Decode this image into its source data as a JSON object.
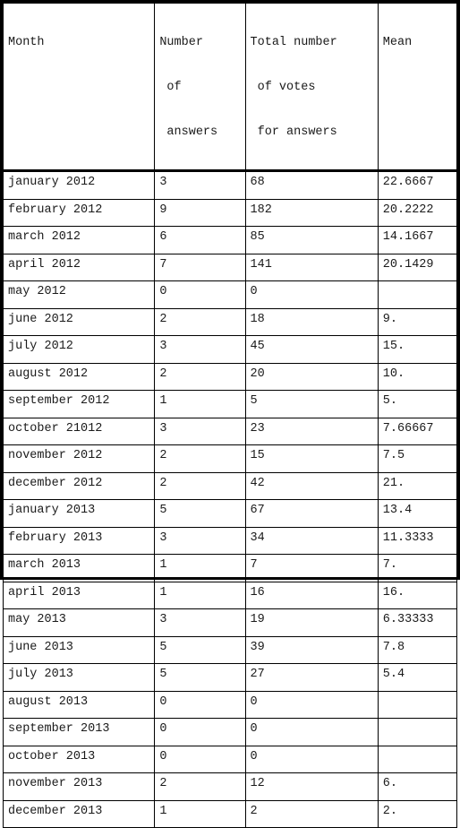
{
  "table": {
    "columns": [
      {
        "key": "month",
        "header_lines": [
          "Month"
        ]
      },
      {
        "key": "answers",
        "header_lines": [
          "Number",
          " of",
          " answers"
        ]
      },
      {
        "key": "votes",
        "header_lines": [
          "Total number",
          " of votes",
          " for answers"
        ]
      },
      {
        "key": "mean",
        "header_lines": [
          "Mean"
        ]
      }
    ],
    "headers": {
      "month": "Month",
      "answers_l1": "Number",
      "answers_l2": " of",
      "answers_l3": " answers",
      "votes_l1": "Total number",
      "votes_l2": " of votes",
      "votes_l3": " for answers",
      "mean": "Mean"
    },
    "rows": [
      {
        "month": "january 2012",
        "answers": "3",
        "votes": "68",
        "mean": "22.6667"
      },
      {
        "month": "february 2012",
        "answers": "9",
        "votes": "182",
        "mean": "20.2222"
      },
      {
        "month": "march 2012",
        "answers": "6",
        "votes": "85",
        "mean": "14.1667"
      },
      {
        "month": "april 2012",
        "answers": "7",
        "votes": "141",
        "mean": "20.1429"
      },
      {
        "month": "may 2012",
        "answers": "0",
        "votes": "0",
        "mean": ""
      },
      {
        "month": "june 2012",
        "answers": "2",
        "votes": "18",
        "mean": "9."
      },
      {
        "month": "july 2012",
        "answers": "3",
        "votes": "45",
        "mean": "15."
      },
      {
        "month": "august 2012",
        "answers": "2",
        "votes": "20",
        "mean": "10."
      },
      {
        "month": "september 2012",
        "answers": "1",
        "votes": "5",
        "mean": "5."
      },
      {
        "month": "october 21012",
        "answers": "3",
        "votes": "23",
        "mean": "7.66667"
      },
      {
        "month": "november 2012",
        "answers": "2",
        "votes": "15",
        "mean": "7.5"
      },
      {
        "month": "december 2012",
        "answers": "2",
        "votes": "42",
        "mean": "21."
      },
      {
        "month": "january 2013",
        "answers": "5",
        "votes": "67",
        "mean": "13.4"
      },
      {
        "month": "february 2013",
        "answers": "3",
        "votes": "34",
        "mean": "11.3333"
      },
      {
        "month": "march 2013",
        "answers": "1",
        "votes": "7",
        "mean": "7."
      },
      {
        "month": "april 2013",
        "answers": "1",
        "votes": "16",
        "mean": "16."
      },
      {
        "month": "may 2013",
        "answers": "3",
        "votes": "19",
        "mean": "6.33333"
      },
      {
        "month": "june 2013",
        "answers": "5",
        "votes": "39",
        "mean": "7.8"
      },
      {
        "month": "july 2013",
        "answers": "5",
        "votes": "27",
        "mean": "5.4"
      },
      {
        "month": "august 2013",
        "answers": "0",
        "votes": "0",
        "mean": ""
      },
      {
        "month": "september 2013",
        "answers": "0",
        "votes": "0",
        "mean": ""
      },
      {
        "month": "october 2013",
        "answers": "0",
        "votes": "0",
        "mean": ""
      },
      {
        "month": "november 2013",
        "answers": "2",
        "votes": "12",
        "mean": "6."
      },
      {
        "month": "december 2013",
        "answers": "1",
        "votes": "2",
        "mean": "2."
      }
    ]
  },
  "style": {
    "border_color": "#000000",
    "text_color": "#1a1a1a",
    "background": "#ffffff"
  }
}
